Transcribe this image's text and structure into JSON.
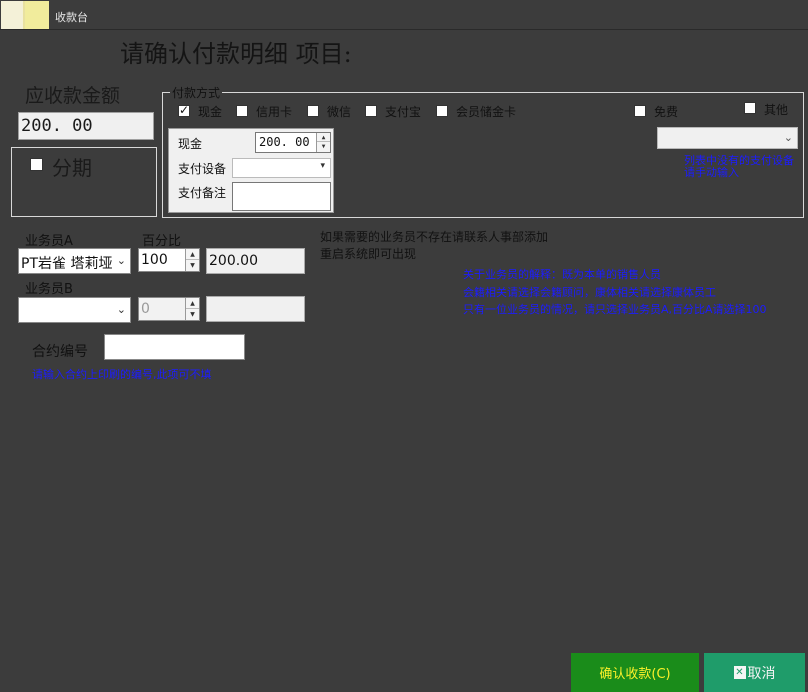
{
  "window": {
    "title": "收款台"
  },
  "headline": "请确认付款明细  项目:",
  "amount": {
    "label": "应收款金额",
    "value": "200. 00"
  },
  "installment": {
    "label": "分期",
    "checked": false
  },
  "payment": {
    "legend": "付款方式",
    "methods": [
      {
        "label": "现金",
        "checked": true
      },
      {
        "label": "信用卡",
        "checked": false
      },
      {
        "label": "微信",
        "checked": false
      },
      {
        "label": "支付宝",
        "checked": false
      },
      {
        "label": "会员储金卡",
        "checked": false
      },
      {
        "label": "免费",
        "checked": false
      },
      {
        "label": "其他",
        "checked": false
      }
    ],
    "other_hint": "列表中没有的支付设备请手动输入",
    "cash": {
      "label": "现金",
      "value": "200. 00",
      "device_label": "支付设备",
      "memo_label": "支付备注"
    }
  },
  "sales": {
    "a_label": "业务员A",
    "pct_label": "百分比",
    "a_value": "PT岩雀 塔莉垭",
    "a_pct": "100",
    "a_amount": "200.00",
    "b_label": "业务员B",
    "b_value": "",
    "b_pct": "0",
    "b_amount": ""
  },
  "notes": {
    "not_found_1": "如果需要的业务员不存在请联系人事部添加",
    "not_found_2": "重启系统即可出现",
    "explain_1": "关于业务员的解释：既为本单的销售人员",
    "explain_2": "会籍相关请选择会籍顾问，康体相关请选择康体员工",
    "explain_3": "只有一位业务员的情况，请只选择业务员A,百分比A请选择100"
  },
  "contract": {
    "label": "合约编号",
    "value": "",
    "hint": "请输入合约上印刷的编号,此项可不填"
  },
  "buttons": {
    "confirm": "确认收款(C)",
    "cancel": "取消"
  },
  "colors": {
    "background": "#3c3c3c",
    "hint_blue": "#1c1cff",
    "confirm_bg": "#1a8c1a",
    "confirm_text": "#fdf12a",
    "cancel_bg": "#1f9c6a"
  }
}
